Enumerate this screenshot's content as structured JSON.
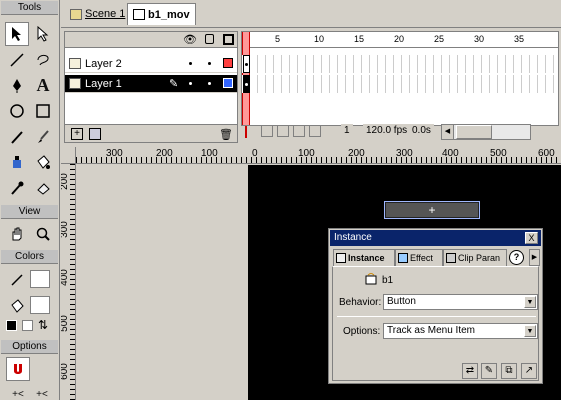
{
  "tools_panel": {
    "title": "Tools",
    "view_title": "View",
    "colors_title": "Colors",
    "options_title": "Options",
    "tools": [
      "arrow-icon",
      "subselect-icon",
      "line-icon",
      "lasso-icon",
      "pen-icon",
      "text-icon",
      "oval-icon",
      "rectangle-icon",
      "pencil-icon",
      "brush-icon",
      "ink-bottle-icon",
      "paint-bucket-icon",
      "eyedropper-icon",
      "eraser-icon"
    ],
    "view_tools": [
      "hand-icon",
      "zoom-icon"
    ]
  },
  "scene_bar": {
    "scene_label": "Scene 1",
    "symbol_label": "b1_mov"
  },
  "timeline": {
    "layers": [
      {
        "name": "Layer 2",
        "selected": false,
        "color": "#ff4040"
      },
      {
        "name": "Layer 1",
        "selected": true,
        "color": "#3366ff"
      }
    ],
    "frame_numbers": [
      "1",
      "5",
      "10",
      "15",
      "20",
      "25",
      "30",
      "35"
    ],
    "current_frame": "1",
    "frame_rate": "120.0 fps",
    "elapsed": "0.0s"
  },
  "rulers": {
    "horizontal": [
      "300",
      "200",
      "100",
      "0",
      "100",
      "200",
      "300",
      "400",
      "500",
      "600"
    ],
    "vertical": [
      "200",
      "300",
      "400",
      "500",
      "600"
    ]
  },
  "stage": {
    "instance_glyph": "+"
  },
  "instance_panel": {
    "title": "Instance",
    "close": "X",
    "tabs": [
      "Instance",
      "Effect",
      "Clip Paran"
    ],
    "symbol_name": "b1",
    "behavior_label": "Behavior:",
    "behavior_value": "Button",
    "options_label": "Options:",
    "options_value": "Track as Menu Item",
    "help": "?"
  }
}
